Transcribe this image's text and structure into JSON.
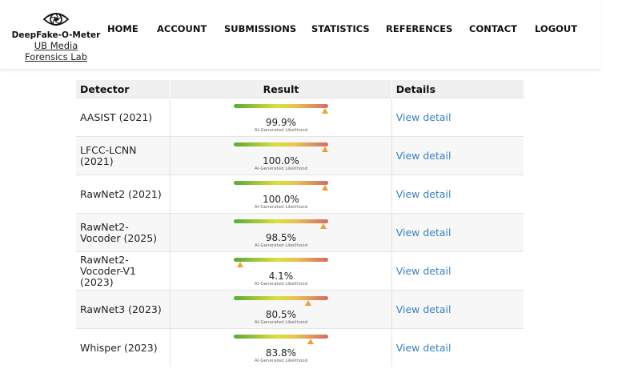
{
  "brand": {
    "name": "DeepFake-O-Meter",
    "lab_line1": "UB Media",
    "lab_line2": "Forensics Lab",
    "logo_icon": "eye-shutter-icon"
  },
  "nav": {
    "items": [
      {
        "label": "HOME"
      },
      {
        "label": "ACCOUNT"
      },
      {
        "label": "SUBMISSIONS"
      },
      {
        "label": "STATISTICS"
      },
      {
        "label": "REFERENCES"
      },
      {
        "label": "CONTACT"
      },
      {
        "label": "LOGOUT"
      }
    ]
  },
  "table": {
    "headers": {
      "detector": "Detector",
      "result": "Result",
      "details": "Details"
    },
    "caption": "AI-Generated Likelihood",
    "link_label": "View detail",
    "colors": {
      "link": "#3a7fc4",
      "marker": "#f0a030",
      "gradient_start": "#5aa838",
      "gradient_mid": "#d9e03c",
      "gradient_end": "#d56b64"
    },
    "rows": [
      {
        "detector": "AASIST (2021)",
        "result": "99.9%",
        "likelihood": 0.999
      },
      {
        "detector": "LFCC-LCNN (2021)",
        "result": "100.0%",
        "likelihood": 1.0
      },
      {
        "detector": "RawNet2 (2021)",
        "result": "100.0%",
        "likelihood": 1.0
      },
      {
        "detector": "RawNet2-Vocoder (2025)",
        "result": "98.5%",
        "likelihood": 0.985
      },
      {
        "detector": "RawNet2-Vocoder-V1 (2023)",
        "result": "4.1%",
        "likelihood": 0.041
      },
      {
        "detector": "RawNet3 (2023)",
        "result": "80.5%",
        "likelihood": 0.805
      },
      {
        "detector": "Whisper (2023)",
        "result": "83.8%",
        "likelihood": 0.838
      }
    ]
  }
}
